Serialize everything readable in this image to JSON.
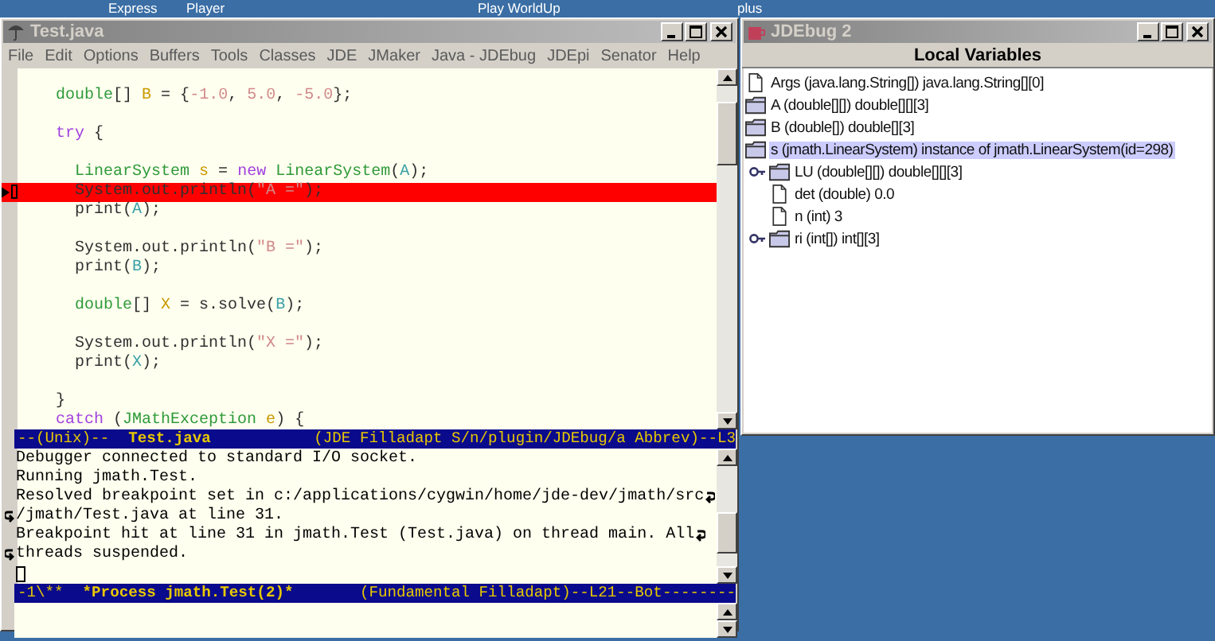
{
  "desktop_labels": [
    {
      "text": "Express"
    },
    {
      "text": "Player"
    },
    {
      "text": "Play WorldUp"
    },
    {
      "text": "plus"
    }
  ],
  "editor": {
    "title": "Test.java",
    "menu": [
      "File",
      "Edit",
      "Options",
      "Buffers",
      "Tools",
      "Classes",
      "JDE",
      "JMaker",
      "Java - JDEbug",
      "JDEpi",
      "Senator",
      "Help"
    ],
    "lines": [
      {
        "kind": "blank"
      },
      {
        "kind": "code",
        "segments": [
          {
            "kind": "type",
            "text": "    double"
          },
          {
            "kind": "plain",
            "text": "[] "
          },
          {
            "kind": "var",
            "text": "B"
          },
          {
            "kind": "plain",
            "text": " = {"
          },
          {
            "kind": "num",
            "text": "-1.0"
          },
          {
            "kind": "plain",
            "text": ", "
          },
          {
            "kind": "num",
            "text": "5.0"
          },
          {
            "kind": "plain",
            "text": ", "
          },
          {
            "kind": "num",
            "text": "-5.0"
          },
          {
            "kind": "plain",
            "text": "};"
          }
        ]
      },
      {
        "kind": "blank"
      },
      {
        "kind": "code",
        "segments": [
          {
            "kind": "keyword",
            "text": "    try"
          },
          {
            "kind": "plain",
            "text": " {"
          }
        ]
      },
      {
        "kind": "blank"
      },
      {
        "kind": "code",
        "segments": [
          {
            "kind": "type",
            "text": "      LinearSystem"
          },
          {
            "kind": "var",
            "text": " s"
          },
          {
            "kind": "plain",
            "text": " = "
          },
          {
            "kind": "keyword",
            "text": "new"
          },
          {
            "kind": "type",
            "text": " LinearSystem"
          },
          {
            "kind": "plain",
            "text": "("
          },
          {
            "kind": "arg",
            "text": "A"
          },
          {
            "kind": "plain",
            "text": ");"
          }
        ]
      },
      {
        "kind": "breakpoint",
        "segments": [
          {
            "kind": "plain",
            "text": "      System.out.println("
          },
          {
            "kind": "string",
            "text": "\"A =\""
          },
          {
            "kind": "plain",
            "text": ");"
          }
        ]
      },
      {
        "kind": "code",
        "segments": [
          {
            "kind": "plain",
            "text": "      print("
          },
          {
            "kind": "arg",
            "text": "A"
          },
          {
            "kind": "plain",
            "text": ");"
          }
        ]
      },
      {
        "kind": "blank"
      },
      {
        "kind": "code",
        "segments": [
          {
            "kind": "plain",
            "text": "      System.out.println("
          },
          {
            "kind": "string",
            "text": "\"B =\""
          },
          {
            "kind": "plain",
            "text": ");"
          }
        ]
      },
      {
        "kind": "code",
        "segments": [
          {
            "kind": "plain",
            "text": "      print("
          },
          {
            "kind": "arg",
            "text": "B"
          },
          {
            "kind": "plain",
            "text": ");"
          }
        ]
      },
      {
        "kind": "blank"
      },
      {
        "kind": "code",
        "segments": [
          {
            "kind": "type",
            "text": "      double"
          },
          {
            "kind": "plain",
            "text": "[] "
          },
          {
            "kind": "var",
            "text": "X"
          },
          {
            "kind": "plain",
            "text": " = s.solve("
          },
          {
            "kind": "arg",
            "text": "B"
          },
          {
            "kind": "plain",
            "text": ");"
          }
        ]
      },
      {
        "kind": "blank"
      },
      {
        "kind": "code",
        "segments": [
          {
            "kind": "plain",
            "text": "      System.out.println("
          },
          {
            "kind": "string",
            "text": "\"X =\""
          },
          {
            "kind": "plain",
            "text": ");"
          }
        ]
      },
      {
        "kind": "code",
        "segments": [
          {
            "kind": "plain",
            "text": "      print("
          },
          {
            "kind": "arg",
            "text": "X"
          },
          {
            "kind": "plain",
            "text": ");"
          }
        ]
      },
      {
        "kind": "blank"
      },
      {
        "kind": "code",
        "segments": [
          {
            "kind": "plain",
            "text": "    }"
          }
        ]
      },
      {
        "kind": "code",
        "segments": [
          {
            "kind": "keyword",
            "text": "    catch"
          },
          {
            "kind": "plain",
            "text": " ("
          },
          {
            "kind": "type",
            "text": "JMathException"
          },
          {
            "kind": "var",
            "text": " e"
          },
          {
            "kind": "plain",
            "text": ") {"
          }
        ]
      }
    ],
    "modeline_left": "--(Unix)--",
    "modeline_buffer": "Test.java",
    "modeline_right": "(JDE Filladapt S/n/plugin/JDEbug/a Abbrev)--L3",
    "output": [
      {
        "text": "Debugger connected to standard I/O socket.",
        "kind": "line"
      },
      {
        "text": "Running jmath.Test.",
        "kind": "line"
      },
      {
        "text": "Resolved breakpoint set in c:/applications/cygwin/home/jde-dev/jmath/src",
        "kind": "wraps"
      },
      {
        "text": "/jmath/Test.java at line 31.",
        "kind": "continues"
      },
      {
        "text": "Breakpoint hit at line 31 in jmath.Test (Test.java) on thread main. All",
        "kind": "wraps"
      },
      {
        "text": "threads suspended.",
        "kind": "continues"
      }
    ],
    "modeline2_left": "-1\\**",
    "modeline2_buffer": "*Process jmath.Test(2)*",
    "modeline2_right": "(Fundamental Filladapt)--L21--Bot--------"
  },
  "debugger": {
    "title": "JDEbug 2",
    "header": "Local Variables",
    "tree": [
      {
        "label": "Args (java.lang.String[]) java.lang.String[][0]",
        "kind": "file",
        "selected": false,
        "expandable": false
      },
      {
        "label": "A (double[][]) double[][][3]",
        "kind": "folder",
        "selected": false,
        "expandable": false
      },
      {
        "label": "B (double[]) double[][3]",
        "kind": "folder",
        "selected": false,
        "expandable": false
      },
      {
        "label": "s (jmath.LinearSystem) instance of jmath.LinearSystem(id=298)",
        "kind": "folder",
        "selected": true,
        "expandable": false,
        "children": [
          {
            "label": "LU (double[][]) double[][][3]",
            "kind": "folder",
            "selected": false,
            "expandable": true
          },
          {
            "label": "det (double) 0.0",
            "kind": "file",
            "selected": false,
            "expandable": false
          },
          {
            "label": "n (int) 3",
            "kind": "file",
            "selected": false,
            "expandable": false
          },
          {
            "label": "ri (int[]) int[][3]",
            "kind": "folder",
            "selected": false,
            "expandable": true
          }
        ]
      }
    ]
  }
}
